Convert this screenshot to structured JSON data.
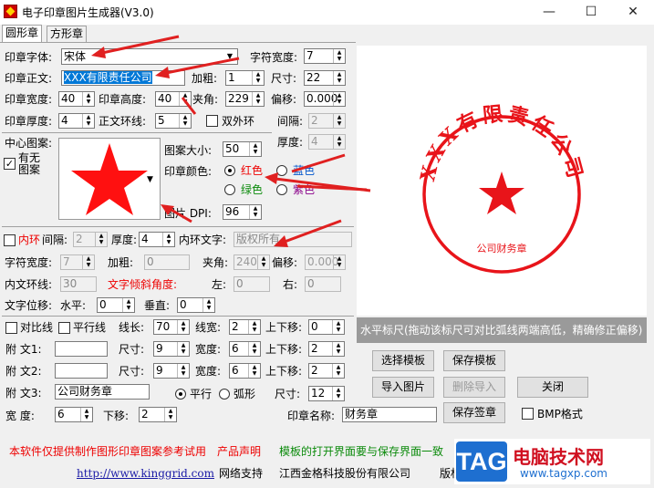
{
  "window": {
    "title": "电子印章图片生成器(V3.0)",
    "minimize": "—",
    "maximize": "☐",
    "close": "✕"
  },
  "tabs": [
    "圆形章",
    "方形章"
  ],
  "form": {
    "font_label": "印章字体:",
    "font_value": "宋体",
    "charwidth_label": "字符宽度:",
    "charwidth_value": "7",
    "text_label": "印章正文:",
    "text_value": "XXX有限责任公司",
    "bold_label": "加粗:",
    "bold_value": "1",
    "size_label": "尺寸:",
    "size_value": "22",
    "width_label": "印章宽度:",
    "width_value": "40",
    "height_label": "印章高度:",
    "height_value": "40",
    "angle_label": "夹角:",
    "angle_value": "229",
    "offset_label": "偏移:",
    "offset_value": "0.000",
    "thickness_label": "印章厚度:",
    "thickness_value": "4",
    "ring_label": "正文环线:",
    "ring_value": "5",
    "double_ring_label": "双外环",
    "gap_label": "间隔:",
    "gap_value": "2",
    "thick2_label": "厚度:",
    "thick2_value": "4",
    "center_label": "中心图案:",
    "has_pattern_label": "有无图案",
    "pattern_size_label": "图案大小:",
    "pattern_size_value": "50",
    "color_label": "印章颜色:",
    "colors": {
      "red": "红色",
      "blue": "蓝色",
      "green": "绿色",
      "purple": "紫色"
    },
    "dpi_label": "图片 DPI:",
    "dpi_value": "96",
    "inner_ring_label": "内环",
    "inner_gap_label": "间隔:",
    "inner_gap_value": "2",
    "inner_thick_label": "厚度:",
    "inner_thick_value": "4",
    "inner_text_label": "内环文字:",
    "inner_text_value": "版权所有",
    "inner_charwidth_label": "字符宽度:",
    "inner_charwidth_value": "7",
    "inner_bold_label": "加粗:",
    "inner_bold_value": "0",
    "inner_angle_label": "夹角:",
    "inner_angle_value": "240",
    "inner_offset_label": "偏移:",
    "inner_offset_value": "0.000",
    "inner_textring_label": "内文环线:",
    "inner_textring_value": "30",
    "tilt_label": "文字倾斜角度:",
    "left_label": "左:",
    "left_value": "0",
    "right_label": "右:",
    "right_value": "0",
    "textpos_label": "文字位移:",
    "horiz_label": "水平:",
    "horiz_value": "0",
    "vert_label": "垂直:",
    "vert_value": "0",
    "diag_label": "对比线",
    "parallel_label": "平行线",
    "linelen_label": "线长:",
    "linelen_value": "70",
    "linewidth_label": "线宽:",
    "linewidth_value": "2",
    "shift_label": "上下移:",
    "shift_value": "0",
    "sub1_label": "附  文1:",
    "sub1_value": "",
    "sub1_size_label": "尺寸:",
    "sub1_size_value": "9",
    "sub1_width_label": "宽度:",
    "sub1_width_value": "6",
    "sub1_shift_label": "上下移:",
    "sub1_shift_value": "2",
    "sub2_label": "附  文2:",
    "sub2_value": "",
    "sub2_size_label": "尺寸:",
    "sub2_size_value": "9",
    "sub2_width_label": "宽度:",
    "sub2_width_value": "6",
    "sub2_shift_label": "上下移:",
    "sub2_shift_value": "2",
    "sub3_label": "附  文3:",
    "sub3_value": "公司财务章",
    "flat_label": "平行",
    "arc_label": "弧形",
    "sub3_size_label": "尺寸:",
    "sub3_size_value": "12",
    "w_label": "宽    度:",
    "w_value": "6",
    "down_label": "下移:",
    "down_value": "2",
    "stamp_name_label": "印章名称:",
    "stamp_name_value": "财务章"
  },
  "ruler_text": "水平标尺(拖动该标尺可对比弧线两端高低，精确修正偏移)",
  "buttons": {
    "select_template": "选择模板",
    "save_template": "保存模板",
    "import_image": "导入图片",
    "delete_import": "删除导入",
    "close": "关闭",
    "save_stamp": "保存签章",
    "bmp_label": "BMP格式"
  },
  "stamp": {
    "top_text": "XXX有限责任公司",
    "bottom_text": "公司财务章",
    "color": "#e8141a"
  },
  "footer": {
    "notice": "本软件仅提供制作图形印章图案参考试用",
    "statement": "产品声明",
    "template_note": "模板的打开界面要与保存界面一致",
    "url": "http://www.kinggrid.com",
    "support": "网络支持",
    "company": "江西金格科技股份有限公司",
    "copyright": "版权"
  },
  "watermark": {
    "tag": "TAG",
    "cn": "电脑技术网",
    "url": "www.tagxp.com"
  }
}
